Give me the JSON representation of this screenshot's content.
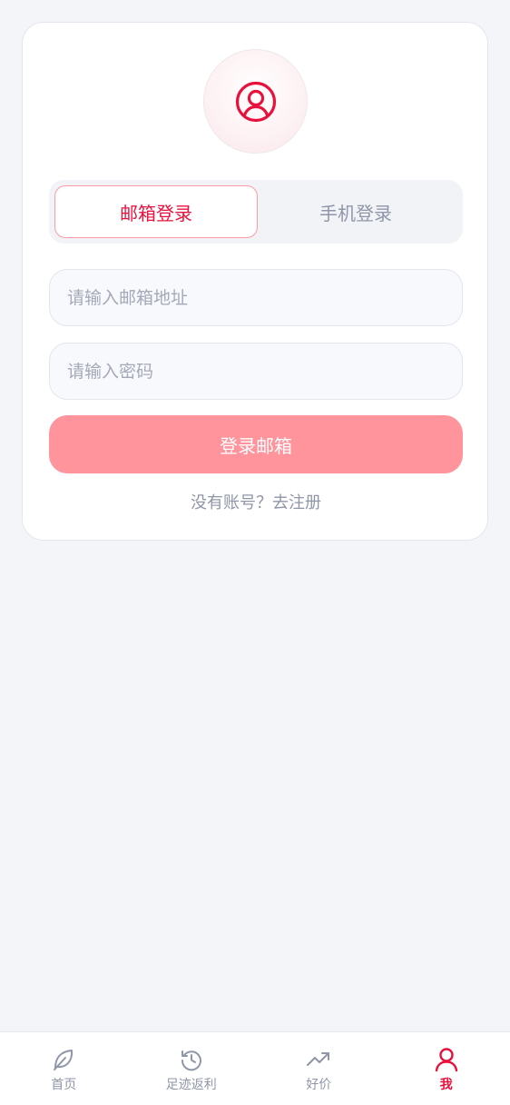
{
  "login": {
    "tabs": [
      {
        "label": "邮箱登录",
        "active": true
      },
      {
        "label": "手机登录",
        "active": false
      }
    ],
    "email_placeholder": "请输入邮箱地址",
    "password_placeholder": "请输入密码",
    "submit_label": "登录邮箱",
    "register_text": "没有账号？去注册"
  },
  "tabbar": {
    "items": [
      {
        "label": "首页",
        "icon": "leaf-icon",
        "active": false
      },
      {
        "label": "足迹返利",
        "icon": "history-icon",
        "active": false
      },
      {
        "label": "好价",
        "icon": "trending-up-icon",
        "active": false
      },
      {
        "label": "我",
        "icon": "user-icon",
        "active": true
      }
    ]
  },
  "colors": {
    "accent": "#e8113c",
    "button": "#ff949d",
    "muted": "#8f96a8",
    "background": "#f4f5f9"
  }
}
